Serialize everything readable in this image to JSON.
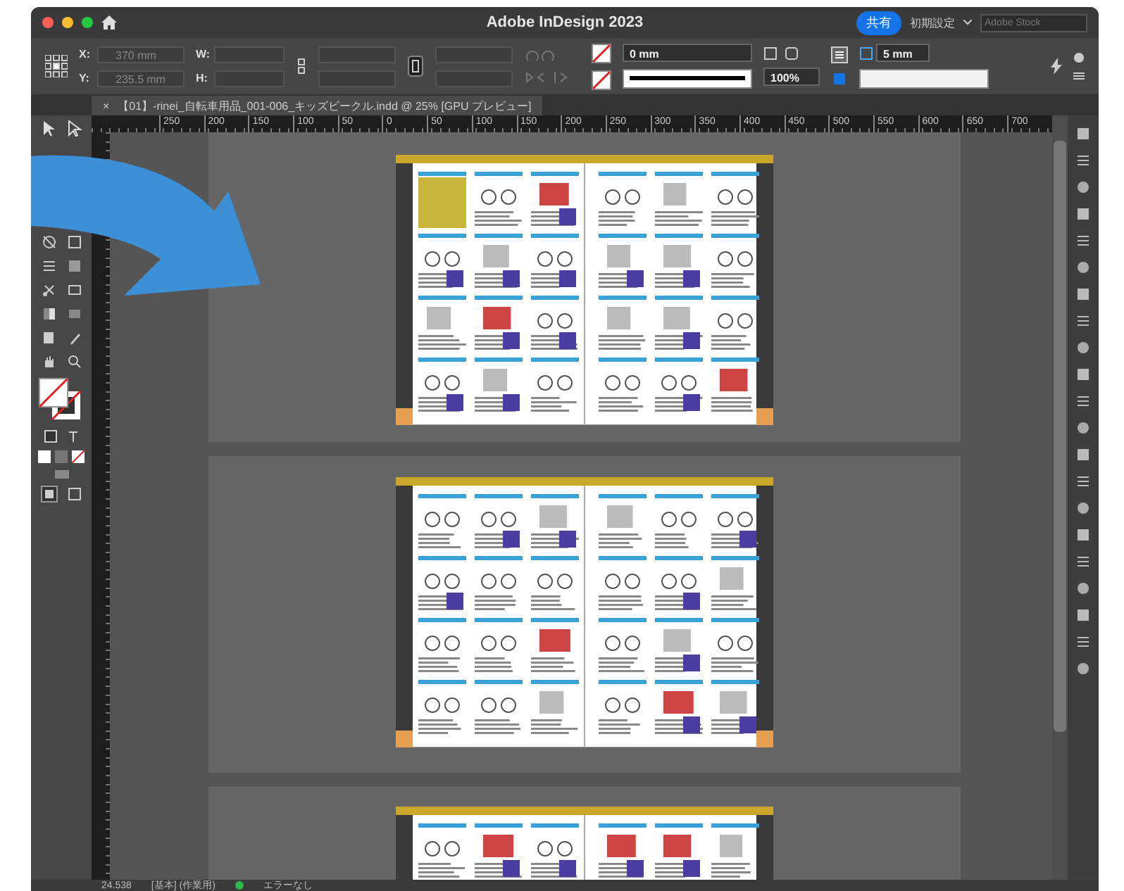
{
  "window": {
    "title": "Adobe InDesign 2023"
  },
  "header": {
    "share_button": "共有",
    "workspace": "初期設定",
    "search": {
      "placeholder": "Adobe Stock"
    }
  },
  "control_bar": {
    "position_fields": [
      {
        "label": "X:",
        "value": "370 mm"
      },
      {
        "label": "Y:",
        "value": "235.5 mm"
      }
    ],
    "size_fields": [
      {
        "label": "W:"
      },
      {
        "label": "H:"
      }
    ],
    "stroke_weight": "0 mm",
    "opacity": "100%",
    "spacing": "5 mm"
  },
  "document_tab": {
    "close": "×",
    "title": "【01】-rinei_自転車用品_001-006_キッズビークル.indd @ 25% [GPU プレビュー]"
  },
  "ruler": {
    "ticks": [
      "250",
      "200",
      "150",
      "100",
      "50",
      "0",
      "50",
      "100",
      "150",
      "200",
      "250",
      "300",
      "350",
      "400",
      "450",
      "500",
      "550",
      "600",
      "650",
      "700"
    ]
  },
  "status_bar": {
    "zoom": "24.538",
    "style": "[基本] (作業用)",
    "preflight": "エラーなし"
  }
}
